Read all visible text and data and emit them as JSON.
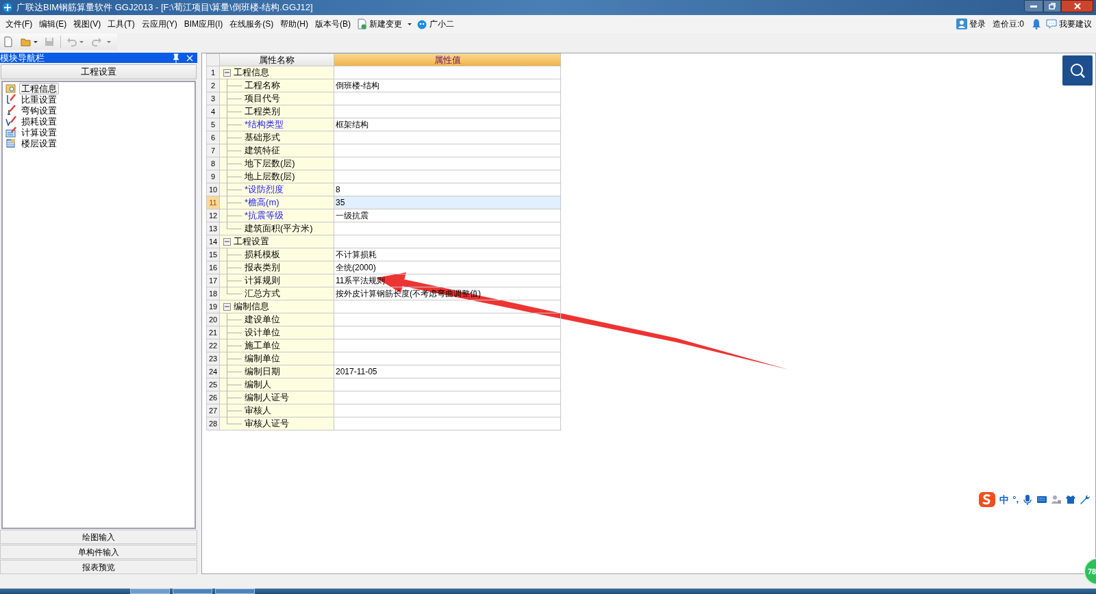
{
  "window": {
    "title": "广联达BIM钢筋算量软件 GGJ2013 - [F:\\荀江项目\\算量\\倒班楼-结构.GGJ12]"
  },
  "menu": {
    "items": [
      "文件(F)",
      "编辑(E)",
      "视图(V)",
      "工具(T)",
      "云应用(Y)",
      "BIM应用(I)",
      "在线服务(S)",
      "帮助(H)",
      "版本号(B)"
    ],
    "new_change": "新建变更",
    "assistant": "广小二"
  },
  "account_bar": {
    "login": "登录",
    "points": "造价豆:0",
    "feedback": "我要建议"
  },
  "toolbar": {
    "undo_disabled": true
  },
  "nav_panel": {
    "title": "模块导航栏",
    "section": "工程设置",
    "items": [
      {
        "label": "工程信息",
        "selected": true
      },
      {
        "label": "比重设置",
        "selected": false
      },
      {
        "label": "弯钩设置",
        "selected": false
      },
      {
        "label": "损耗设置",
        "selected": false
      },
      {
        "label": "计算设置",
        "selected": false
      },
      {
        "label": "楼层设置",
        "selected": false
      }
    ],
    "bottom_tabs": [
      "绘图输入",
      "单构件输入",
      "报表预览"
    ]
  },
  "grid": {
    "columns": [
      "属性名称",
      "属性值"
    ],
    "groups": [
      {
        "number": "1",
        "label": "工程信息",
        "expanded": true,
        "children": [
          {
            "number": "2",
            "label": "工程名称",
            "value": "倒班楼-结构",
            "required": false,
            "selected": false
          },
          {
            "number": "3",
            "label": "项目代号",
            "required": false,
            "selected": false
          },
          {
            "number": "4",
            "label": "工程类别",
            "required": false,
            "selected": false
          },
          {
            "number": "5",
            "label": "*结构类型",
            "value": "框架结构",
            "required": true,
            "selected": false
          },
          {
            "number": "6",
            "label": "基础形式",
            "required": false,
            "selected": false
          },
          {
            "number": "7",
            "label": "建筑特征",
            "required": false,
            "selected": false
          },
          {
            "number": "8",
            "label": "地下层数(层)",
            "required": false,
            "selected": false
          },
          {
            "number": "9",
            "label": "地上层数(层)",
            "required": false,
            "selected": false
          },
          {
            "number": "10",
            "label": "*设防烈度",
            "value": "8",
            "required": true,
            "selected": false
          },
          {
            "number": "11",
            "label": "*檐高(m)",
            "value": "35",
            "required": true,
            "selected": true
          },
          {
            "number": "12",
            "label": "*抗震等级",
            "value": "一级抗震",
            "required": true,
            "selected": false
          },
          {
            "number": "13",
            "label": "建筑面积(平方米)",
            "required": false,
            "selected": false
          }
        ]
      },
      {
        "number": "14",
        "label": "工程设置",
        "expanded": true,
        "children": [
          {
            "number": "15",
            "label": "损耗模板",
            "value": "不计算损耗",
            "required": false,
            "selected": false
          },
          {
            "number": "16",
            "label": "报表类别",
            "value": "全统(2000)",
            "required": false,
            "selected": false
          },
          {
            "number": "17",
            "label": "计算规则",
            "value": "11系平法规则",
            "required": false,
            "selected": false
          },
          {
            "number": "18",
            "label": "汇总方式",
            "value": "按外皮计算钢筋长度(不考虑弯曲调整值)",
            "required": false,
            "selected": false
          }
        ]
      },
      {
        "number": "19",
        "label": "编制信息",
        "expanded": true,
        "children": [
          {
            "number": "20",
            "label": "建设单位",
            "required": false,
            "selected": false
          },
          {
            "number": "21",
            "label": "设计单位",
            "required": false,
            "selected": false
          },
          {
            "number": "22",
            "label": "施工单位",
            "required": false,
            "selected": false
          },
          {
            "number": "23",
            "label": "编制单位",
            "required": false,
            "selected": false
          },
          {
            "number": "24",
            "label": "编制日期",
            "value": "2017-11-05",
            "required": false,
            "selected": false
          },
          {
            "number": "25",
            "label": "编制人",
            "required": false,
            "selected": false
          },
          {
            "number": "26",
            "label": "编制人证号",
            "required": false,
            "selected": false
          },
          {
            "number": "27",
            "label": "审核人",
            "required": false,
            "selected": false
          },
          {
            "number": "28",
            "label": "审核人证号",
            "required": false,
            "selected": false
          }
        ]
      }
    ]
  },
  "ime_bar": {
    "mode": "中",
    "punctuation": "°,"
  },
  "badge": {
    "text": "78"
  }
}
